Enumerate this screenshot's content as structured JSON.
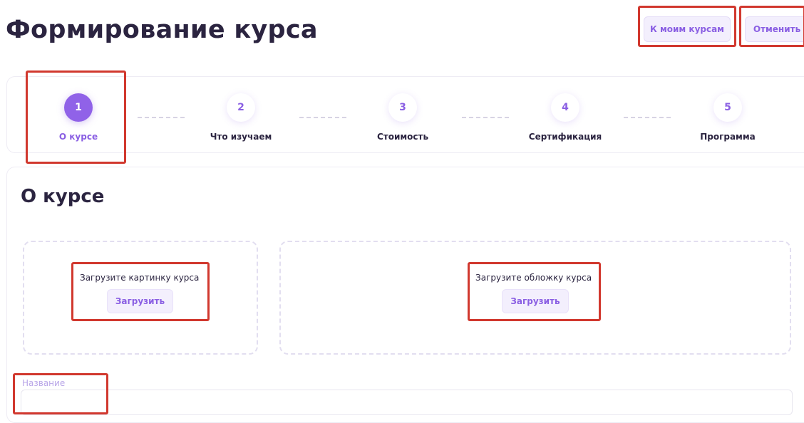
{
  "header": {
    "title": "Формирование курса",
    "to_courses_label": "К моим курсам",
    "cancel_label": "Отменить"
  },
  "stepper": {
    "steps": [
      {
        "number": "1",
        "label": "О курсе",
        "active": true
      },
      {
        "number": "2",
        "label": "Что изучаем",
        "active": false
      },
      {
        "number": "3",
        "label": "Стоимость",
        "active": false
      },
      {
        "number": "4",
        "label": "Сертификация",
        "active": false
      },
      {
        "number": "5",
        "label": "Программа",
        "active": false
      }
    ]
  },
  "section": {
    "title": "О курсе",
    "upload_image": {
      "text": "Загрузите картинку курса",
      "button": "Загрузить"
    },
    "upload_cover": {
      "text": "Загрузите обложку курса",
      "button": "Загрузить"
    },
    "name_field": {
      "label": "Название",
      "value": ""
    }
  },
  "colors": {
    "accent": "#9062e8",
    "accent_text": "#8a5fe3",
    "soft_bg": "#f3effd",
    "heading": "#2b2440",
    "highlight": "#d1382e"
  }
}
